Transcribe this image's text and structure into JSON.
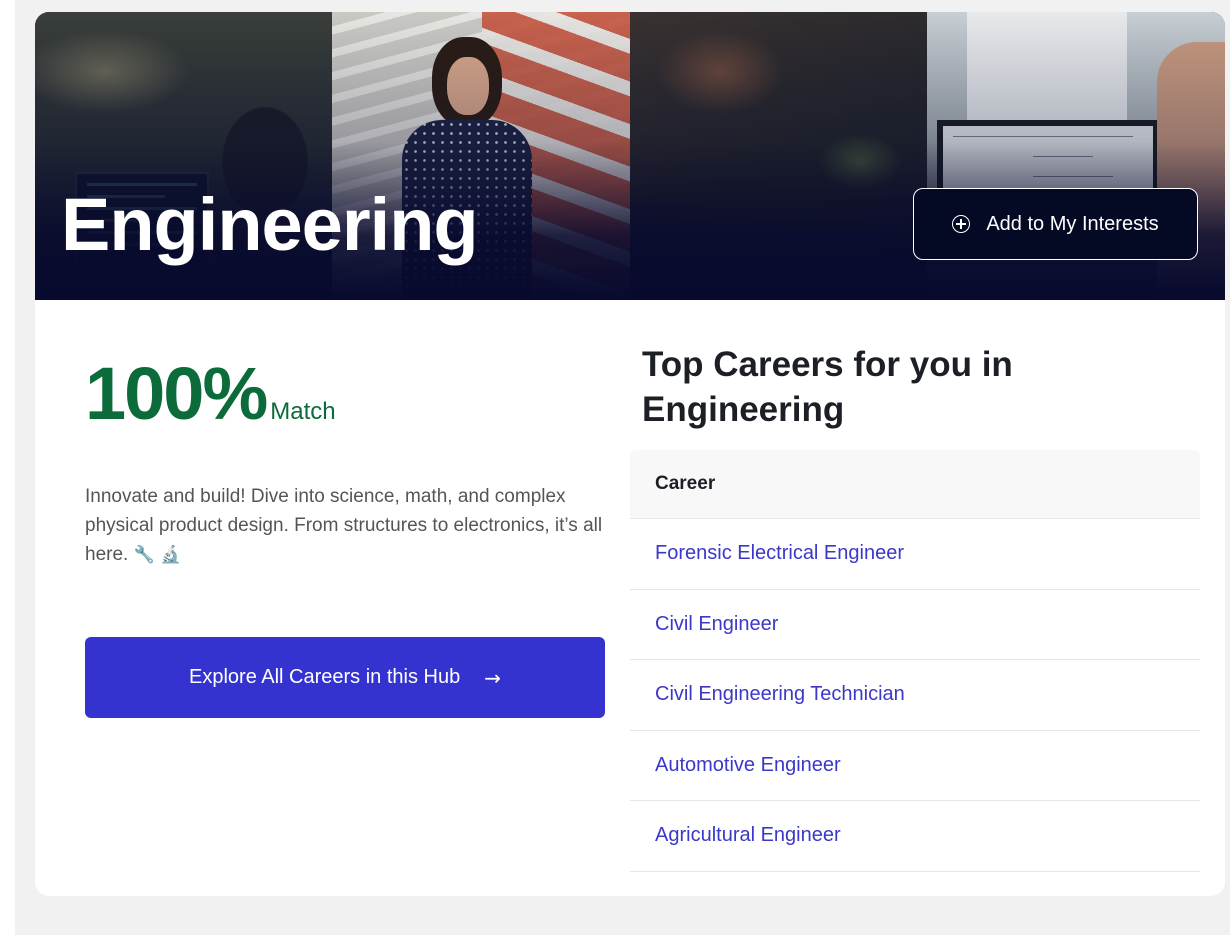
{
  "hero": {
    "title": "Engineering",
    "add_interest_label": "Add to My Interests",
    "add_interest_icon": "plus-circle-icon"
  },
  "match": {
    "value": "100%",
    "label": "Match",
    "color": "#0b6b3a"
  },
  "description": {
    "text": "Innovate and build! Dive into science, math, and complex physical product design. From structures to electronics, it’s all here.",
    "emojis": "🔧 🔬"
  },
  "explore": {
    "label": "Explore All Careers in this Hub",
    "icon": "arrow-right-icon",
    "color": "#3433cf"
  },
  "careers": {
    "title": "Top Careers for you in Engineering",
    "column_header": "Career",
    "rows": [
      "Forensic Electrical Engineer",
      "Civil Engineer",
      "Civil Engineering Technician",
      "Automotive Engineer",
      "Agricultural Engineer"
    ],
    "link_color": "#3b38c9"
  }
}
